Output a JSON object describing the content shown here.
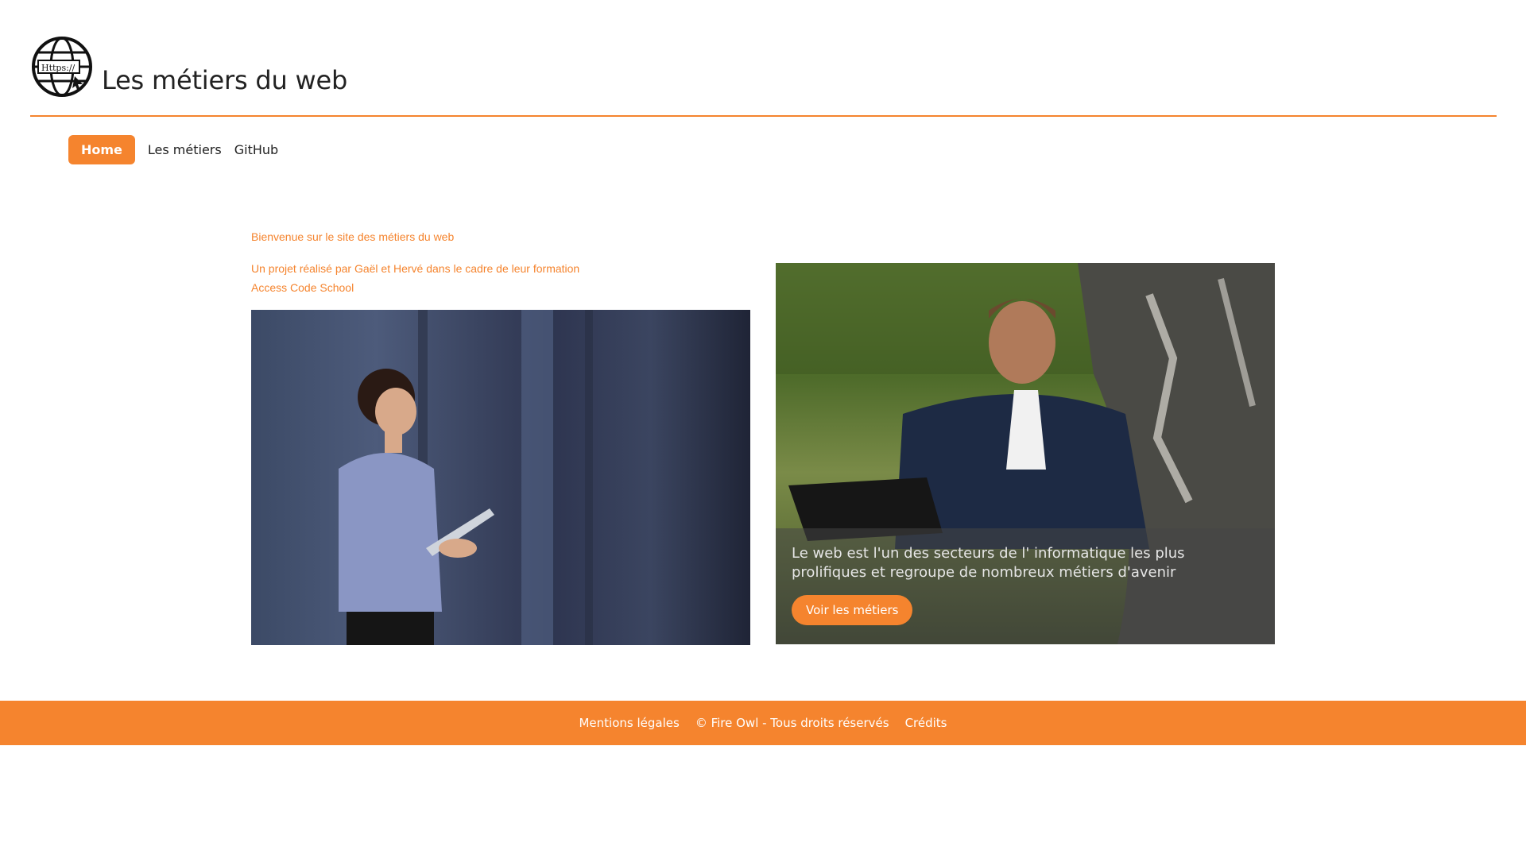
{
  "header": {
    "title": "Les métiers du web",
    "logo_text": "Https://"
  },
  "nav": {
    "items": [
      {
        "label": "Home",
        "active": true
      },
      {
        "label": "Les métiers",
        "active": false
      },
      {
        "label": "GitHub",
        "active": false
      }
    ]
  },
  "intro": {
    "welcome": "Bienvenue sur le site des métiers du web",
    "project_line1": "Un projet réalisé par Gaël et Hervé dans le cadre de leur formation",
    "project_line2": "Access Code School"
  },
  "hero": {
    "caption": "Le web est l'un des secteurs de l' informatique les plus prolifiques et regroupe de nombreux métiers d'avenir",
    "button": "Voir les métiers"
  },
  "footer": {
    "items": [
      "Mentions légales",
      "© Fire Owl - Tous droits réservés",
      "Crédits"
    ]
  },
  "colors": {
    "accent": "#f5842e"
  }
}
